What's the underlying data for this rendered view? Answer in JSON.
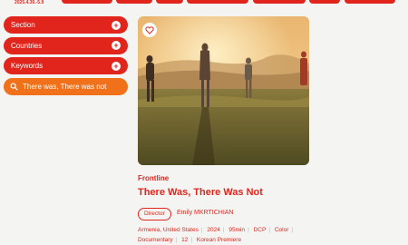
{
  "header": {
    "date_range": "2025.4.30.-5.9"
  },
  "sidebar": {
    "filters": [
      {
        "label": "Section"
      },
      {
        "label": "Countries"
      },
      {
        "label": "Keywords"
      }
    ],
    "search_value": "There was, There was not"
  },
  "film": {
    "section": "Frontline",
    "title": "There Was, There Was Not",
    "director_label": "Director",
    "director_name": "Emily MKRTICHIAN",
    "meta": [
      "Armenia, United States",
      "2024",
      "95min",
      "DCP",
      "Color",
      "Documentary",
      "12",
      "Korean Premiere"
    ]
  },
  "colors": {
    "accent": "#e2251c",
    "search_bg": "#f0711a"
  }
}
